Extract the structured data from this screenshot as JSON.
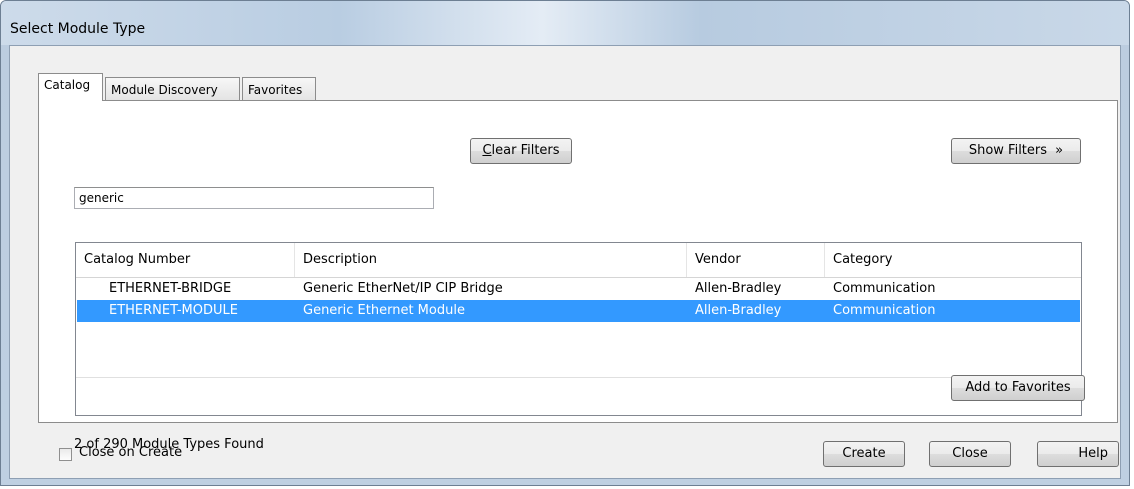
{
  "window": {
    "title": "Select Module Type"
  },
  "tabs": [
    {
      "label": "Catalog",
      "active": true
    },
    {
      "label": "Module Discovery",
      "active": false
    },
    {
      "label": "Favorites",
      "active": false
    }
  ],
  "filter": {
    "search_value": "generic",
    "clear_filters_label": "Clear Filters",
    "show_filters_label": "Show Filters"
  },
  "table": {
    "columns": [
      "Catalog Number",
      "Description",
      "Vendor",
      "Category"
    ],
    "rows": [
      {
        "catalog": "ETHERNET-BRIDGE",
        "description": "Generic EtherNet/IP CIP Bridge",
        "vendor": "Allen-Bradley",
        "category": "Communication",
        "selected": false
      },
      {
        "catalog": "ETHERNET-MODULE",
        "description": "Generic Ethernet Module",
        "vendor": "Allen-Bradley",
        "category": "Communication",
        "selected": true
      }
    ]
  },
  "status_text": "2 of 290 Module Types Found",
  "add_to_favorites_label": "Add to Favorites",
  "footer": {
    "close_on_create_label": "Close on Create",
    "close_on_create_checked": false,
    "create_label": "Create",
    "close_label": "Close",
    "help_label": "Help"
  },
  "colors": {
    "selection": "#3399ff",
    "window_frame": "#bfd0e2",
    "dialog_bg": "#f0f0f0"
  }
}
